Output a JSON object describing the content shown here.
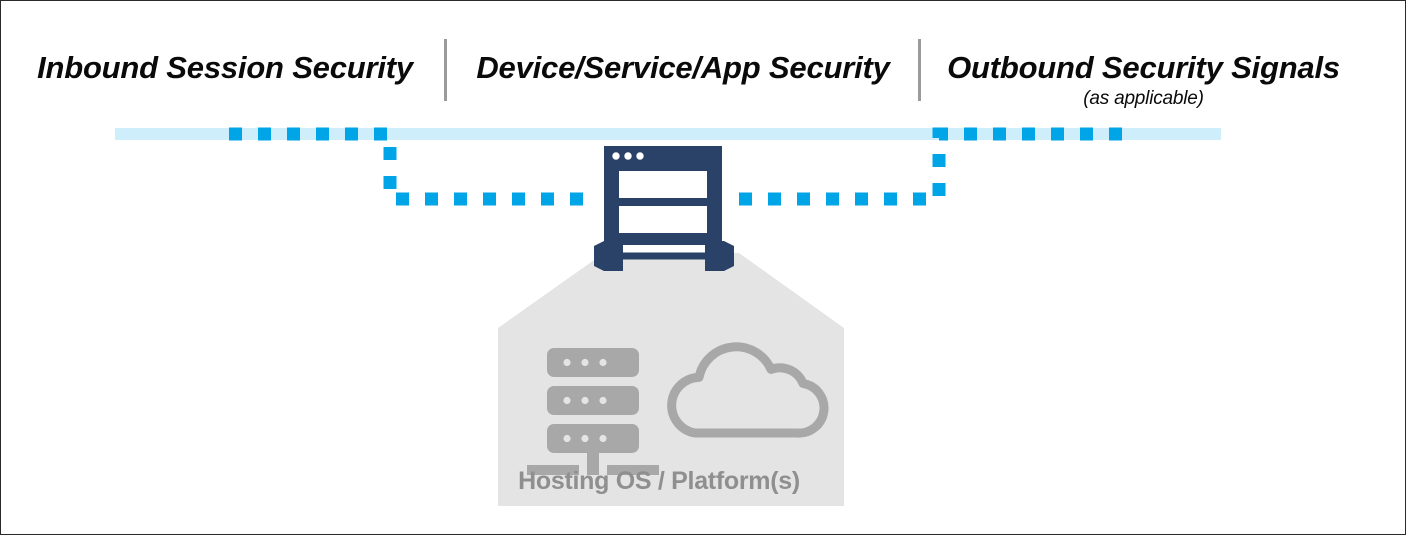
{
  "diagram": {
    "title": "Security layers across inbound session, device/service/app, and outbound signals",
    "background_color": "#ffffff",
    "border_color": "#2a2a2a"
  },
  "columns": [
    {
      "id": "inbound",
      "label": "Inbound Session Security",
      "sublabel": ""
    },
    {
      "id": "device",
      "label": "Device/Service/App Security",
      "sublabel": ""
    },
    {
      "id": "outbound",
      "label": "Outbound Security Signals",
      "sublabel": "(as applicable)"
    }
  ],
  "dividers": {
    "color": "#9b9b9b",
    "count": 2
  },
  "flow": {
    "rail_label": "network-rail",
    "rail_color": "#cdeefa",
    "dash_color": "#00a5e8",
    "dash_description": "dashed session path routed down through the app window and back up",
    "arrow_color": "#2b4268",
    "arrow_label": "bidirectional-app-platform-arrow"
  },
  "app_window": {
    "label": "application-window-icon",
    "body_color": "#2b4268",
    "panel_color": "#ffffff",
    "titlebar_dots": 3
  },
  "platform": {
    "label": "Hosting OS / Platform(s)",
    "block_color": "#e4e4e4",
    "roof_color": "#e4e4e4",
    "text_color": "#8f8f8f",
    "icon_color": "#a8a8a8",
    "icons": [
      {
        "name": "server-rack-icon",
        "units": 3,
        "dots_per_unit": 3
      },
      {
        "name": "cloud-icon"
      }
    ]
  }
}
